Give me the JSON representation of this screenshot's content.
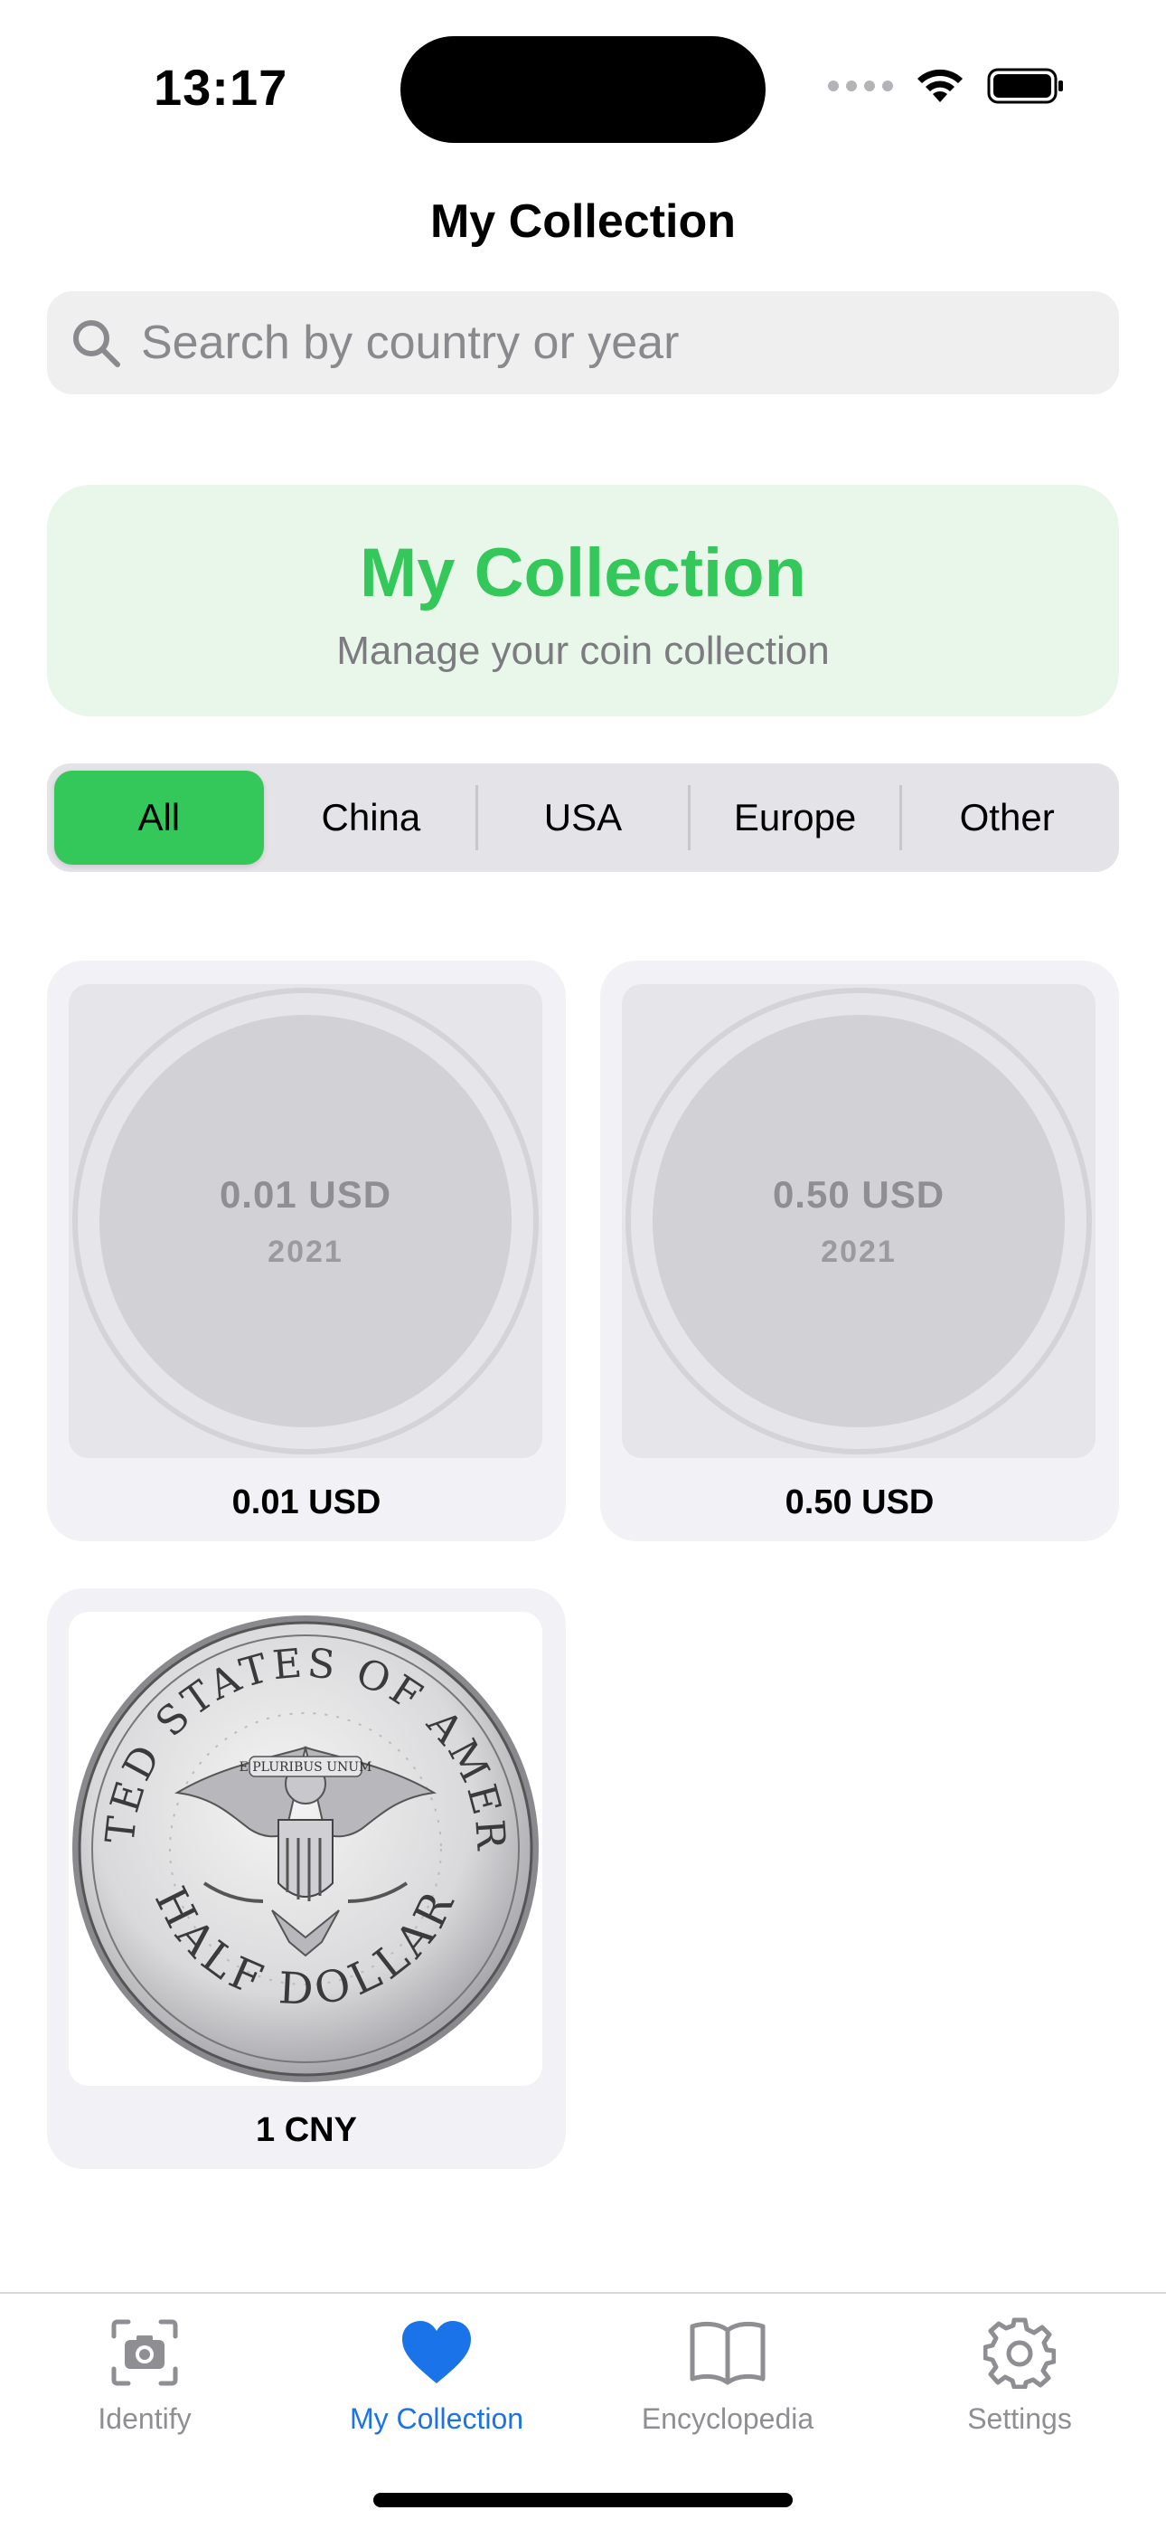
{
  "status": {
    "time": "13:17"
  },
  "nav": {
    "title": "My Collection"
  },
  "search": {
    "placeholder": "Search by country or year"
  },
  "banner": {
    "title": "My Collection",
    "subtitle": "Manage your coin collection"
  },
  "segments": [
    {
      "label": "All",
      "selected": true
    },
    {
      "label": "China",
      "selected": false
    },
    {
      "label": "USA",
      "selected": false
    },
    {
      "label": "Europe",
      "selected": false
    },
    {
      "label": "Other",
      "selected": false
    }
  ],
  "coins": [
    {
      "value": "0.01 USD",
      "year": "2021",
      "label": "0.01 USD",
      "has_photo": false
    },
    {
      "value": "0.50 USD",
      "year": "2021",
      "label": "0.50 USD",
      "has_photo": false
    },
    {
      "label": "1 CNY",
      "has_photo": true,
      "photo_text_top": "UNITED STATES OF AMERICA",
      "photo_text_bottom": "HALF DOLLAR",
      "photo_motto": "E PLURIBUS UNUM"
    }
  ],
  "tabs": [
    {
      "label": "Identify",
      "icon": "camera-icon",
      "active": false
    },
    {
      "label": "My Collection",
      "icon": "heart-icon",
      "active": true
    },
    {
      "label": "Encyclopedia",
      "icon": "book-icon",
      "active": false
    },
    {
      "label": "Settings",
      "icon": "gear-icon",
      "active": false
    }
  ],
  "colors": {
    "accent_green": "#34c759",
    "banner_bg": "#e9f7ea",
    "tab_active_blue": "#1a73e8"
  }
}
